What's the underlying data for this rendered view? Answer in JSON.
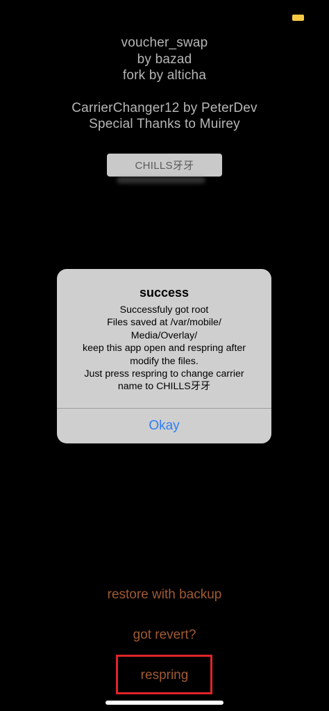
{
  "status_bar": {
    "battery_color": "#f6c945"
  },
  "credits": {
    "line1": "voucher_swap",
    "line2": "by bazad",
    "line3": "fork by alticha",
    "line4": "CarrierChanger12 by PeterDev",
    "line5": "Special Thanks to Muirey"
  },
  "carrier_input": {
    "value": "CHILLS牙牙"
  },
  "alert": {
    "title": "success",
    "message_lines": [
      "Successfuly got root",
      "Files saved at /var/mobile/",
      "Media/Overlay/",
      "keep this app open and respring after",
      "modify the files.",
      "Just press respring to change carrier",
      "name to CHILLS牙牙"
    ],
    "button_label": "Okay",
    "button_color": "#2d7ef5"
  },
  "actions": {
    "restore_label": "restore with backup",
    "revert_label": "got revert?",
    "respring_label": "respring",
    "text_color": "#a05a33",
    "highlight_color": "#e0242a"
  }
}
